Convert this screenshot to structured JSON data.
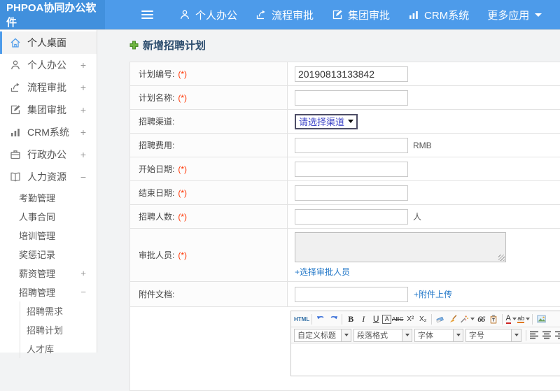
{
  "colors": {
    "header_blue": "#4d9bea",
    "logo_blue": "#4190dd",
    "link_blue": "#2579c9",
    "required_red": "#ff3300",
    "title_color": "#2c4d6e",
    "select_text_blue": "#3c43c8",
    "active_item_border": "#4d9bea"
  },
  "header": {
    "logo": "PHPOA协同办公软件",
    "nav": [
      {
        "label": "个人办公",
        "icon": "person-icon"
      },
      {
        "label": "流程审批",
        "icon": "flow-icon"
      },
      {
        "label": "集团审批",
        "icon": "edit-icon"
      },
      {
        "label": "CRM系统",
        "icon": "chart-icon"
      },
      {
        "label": "更多应用",
        "icon": "caret-down-icon"
      }
    ]
  },
  "sidebar": {
    "items": [
      {
        "label": "个人桌面",
        "icon": "home-icon",
        "active": true
      },
      {
        "label": "个人办公",
        "icon": "person-icon",
        "expand": "+"
      },
      {
        "label": "流程审批",
        "icon": "flow-icon",
        "expand": "+"
      },
      {
        "label": "集团审批",
        "icon": "edit-icon",
        "expand": "+"
      },
      {
        "label": "CRM系统",
        "icon": "chart-icon",
        "expand": "+"
      },
      {
        "label": "行政办公",
        "icon": "briefcase-icon",
        "expand": "+"
      },
      {
        "label": "人力资源",
        "icon": "book-icon",
        "expand": "−"
      }
    ],
    "hr_submenu": [
      {
        "label": "考勤管理"
      },
      {
        "label": "人事合同"
      },
      {
        "label": "培训管理"
      },
      {
        "label": "奖惩记录"
      },
      {
        "label": "薪资管理",
        "expand": "+"
      },
      {
        "label": "招聘管理",
        "expand": "−"
      }
    ],
    "recruit_submenu": [
      {
        "label": "招聘需求"
      },
      {
        "label": "招聘计划"
      },
      {
        "label": "人才库"
      }
    ]
  },
  "main": {
    "page_title": "新增招聘计划",
    "form": {
      "rows": [
        {
          "label": "计划编号:",
          "required": "(*)",
          "value": "20190813133842"
        },
        {
          "label": "计划名称:",
          "required": "(*)",
          "value": ""
        },
        {
          "label": "招聘渠道:",
          "select_value": "请选择渠道"
        },
        {
          "label": "招聘费用:",
          "suffix": "RMB"
        },
        {
          "label": "开始日期:",
          "required": "(*)"
        },
        {
          "label": "结束日期:",
          "required": "(*)"
        },
        {
          "label": "招聘人数:",
          "required": "(*)",
          "suffix": "人"
        },
        {
          "label": "审批人员:",
          "required": "(*)",
          "link": "+选择审批人员"
        },
        {
          "label": "附件文档:",
          "link": "+附件上传"
        }
      ]
    },
    "editor": {
      "toolbar": {
        "html": "HTML",
        "bold": "B",
        "italic": "I",
        "underline": "U",
        "font_border": "A",
        "strike": "ABC",
        "superscript": "X²",
        "subscript": "X₂",
        "quote": "66",
        "font_color": "A",
        "highlight": "ab",
        "dropdown_heading": "自定义标题",
        "dropdown_paragraph": "段落格式",
        "dropdown_font": "字体",
        "dropdown_size": "字号"
      }
    }
  }
}
